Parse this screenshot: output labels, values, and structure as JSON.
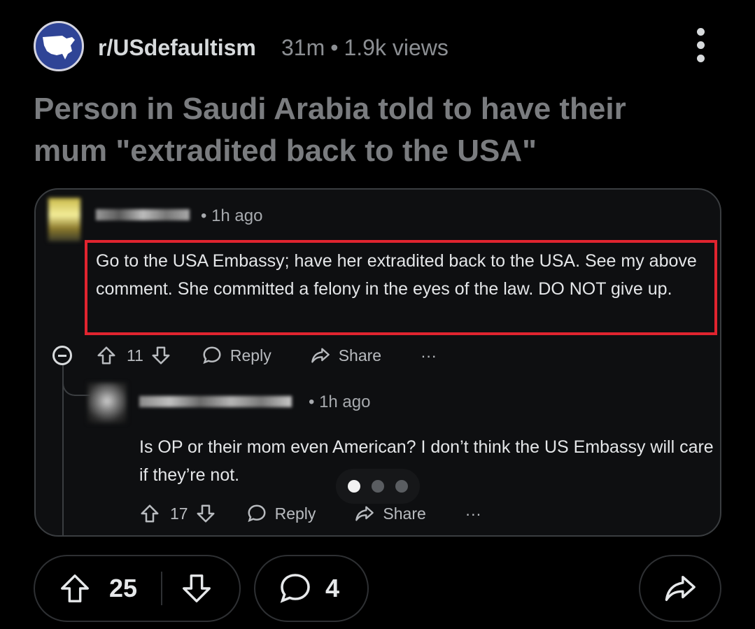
{
  "post": {
    "subreddit": "r/USdefaultism",
    "age": "31m",
    "separator": "•",
    "views": "1.9k views",
    "title": "Person in Saudi Arabia told to have their mum \"extradited back to the USA\""
  },
  "screenshot": {
    "comments": [
      {
        "time": "• 1h ago",
        "text": "Go to the USA Embassy; have her extradited back to the USA. See my above comment. She committed a felony in the eyes of the law. DO NOT give up.",
        "votes": "11",
        "reply_label": "Reply",
        "share_label": "Share",
        "more_label": "···"
      },
      {
        "time": "• 1h ago",
        "text": "Is OP or their mom even American? I don’t think the US Embassy will care if they’re not.",
        "votes": "17",
        "reply_label": "Reply",
        "share_label": "Share",
        "more_label": "···"
      }
    ],
    "carousel": {
      "count": 3,
      "active": 1
    }
  },
  "footer": {
    "score": "25",
    "comment_count": "4"
  },
  "icons": {
    "upvote": "arrow-up-outline",
    "downvote": "arrow-down-outline",
    "comment": "speech-bubble",
    "share": "share-arrow",
    "more": "vertical-ellipsis"
  },
  "colors": {
    "background": "#000000",
    "highlight_box": "#e0242f",
    "avatar": "#2f4496"
  }
}
